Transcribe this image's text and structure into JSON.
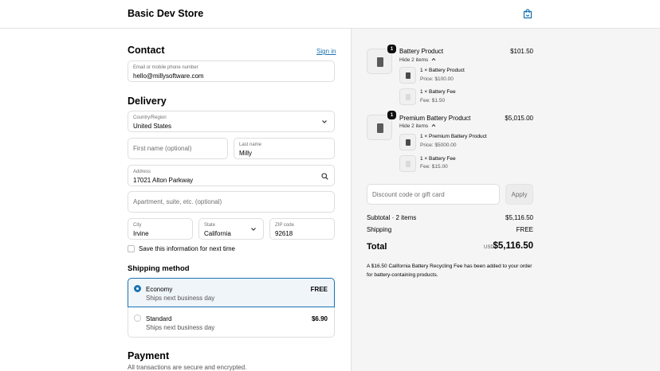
{
  "header": {
    "store_name": "Basic Dev Store",
    "cart_icon": "shopping-bag-icon"
  },
  "contact": {
    "title": "Contact",
    "sign_in": "Sign in",
    "email_label": "Email or mobile phone number",
    "email_value": "hello@millysoftware.com"
  },
  "delivery": {
    "title": "Delivery",
    "country_label": "Country/Region",
    "country_value": "United States",
    "first_name_placeholder": "First name (optional)",
    "last_name_label": "Last name",
    "last_name_value": "Milly",
    "address_label": "Address",
    "address_value": "17021 Alton Parkway",
    "apartment_placeholder": "Apartment, suite, etc. (optional)",
    "city_label": "City",
    "city_value": "Irvine",
    "state_label": "State",
    "state_value": "California",
    "zip_label": "ZIP code",
    "zip_value": "92618",
    "save_info": "Save this information for next time"
  },
  "shipping": {
    "title": "Shipping method",
    "options": [
      {
        "name": "Economy",
        "sub": "Ships next business day",
        "price": "FREE",
        "selected": true
      },
      {
        "name": "Standard",
        "sub": "Ships next business day",
        "price": "$6.90",
        "selected": false
      }
    ]
  },
  "payment": {
    "title": "Payment",
    "sub": "All transactions are secure and encrypted."
  },
  "summary": {
    "items": [
      {
        "qty": "1",
        "name": "Battery Product",
        "price": "$101.50",
        "hide": "Hide 2 items",
        "sub": [
          {
            "line": "1 × Battery Product",
            "detail": "Price: $100.00"
          },
          {
            "line": "1 × Battery Fee",
            "detail": "Fee: $1.50"
          }
        ]
      },
      {
        "qty": "1",
        "name": "Premium Battery Product",
        "price": "$5,015.00",
        "hide": "Hide 2 items",
        "sub": [
          {
            "line": "1 × Premium Battery Product",
            "detail": "Price: $5000.00"
          },
          {
            "line": "1 × Battery Fee",
            "detail": "Fee: $15.00"
          }
        ]
      }
    ],
    "discount_placeholder": "Discount code or gift card",
    "apply_label": "Apply",
    "subtotal_label": "Subtotal · 2 items",
    "subtotal_value": "$5,116.50",
    "shipping_label": "Shipping",
    "shipping_value": "FREE",
    "total_label": "Total",
    "total_currency": "USD",
    "total_value": "$5,116.50",
    "note": "A $16.50 California Battery Recycling Fee has been added to your order for battery-containing products."
  },
  "colors": {
    "accent": "#1773b0",
    "summary_bg": "#f5f5f5",
    "border": "#dedede"
  }
}
